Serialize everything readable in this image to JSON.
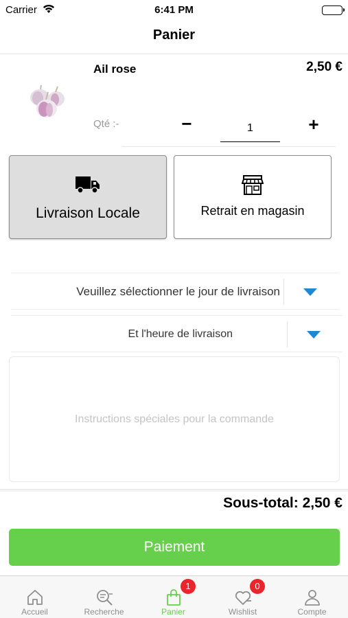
{
  "status_bar": {
    "carrier": "Carrier",
    "time": "6:41 PM"
  },
  "nav": {
    "title": "Panier"
  },
  "cart_item": {
    "name": "Ail rose",
    "price": "2,50 €",
    "qty_label": "Qté :-",
    "qty_minus": "−",
    "qty_value": "1",
    "qty_plus": "+"
  },
  "delivery_options": {
    "local": {
      "label": "Livraison Locale",
      "icon": "truck-icon",
      "selected": true
    },
    "store": {
      "label": "Retrait en magasin",
      "icon": "store-icon",
      "selected": false
    }
  },
  "delivery_day": {
    "placeholder": "Veuillez sélectionner le jour de livraison"
  },
  "delivery_hour": {
    "placeholder": "Et l'heure de livraison"
  },
  "instructions": {
    "placeholder": "Instructions spéciales pour la commande"
  },
  "subtotal": {
    "text": "Sous-total: 2,50 €"
  },
  "pay_button": {
    "label": "Paiement"
  },
  "colors": {
    "accent": "#66cf4b",
    "badge": "#e8262b",
    "dropdown_arrow": "#1e88d2"
  },
  "tabbar": {
    "tabs": [
      {
        "label": "Accueil",
        "icon": "home-icon",
        "active": false
      },
      {
        "label": "Recherche",
        "icon": "search-icon",
        "active": false
      },
      {
        "label": "Panier",
        "icon": "bag-icon",
        "active": true,
        "badge": "1"
      },
      {
        "label": "Wishlist",
        "icon": "heart-icon",
        "active": false,
        "badge": "0"
      },
      {
        "label": "Compte",
        "icon": "user-icon",
        "active": false
      }
    ]
  }
}
